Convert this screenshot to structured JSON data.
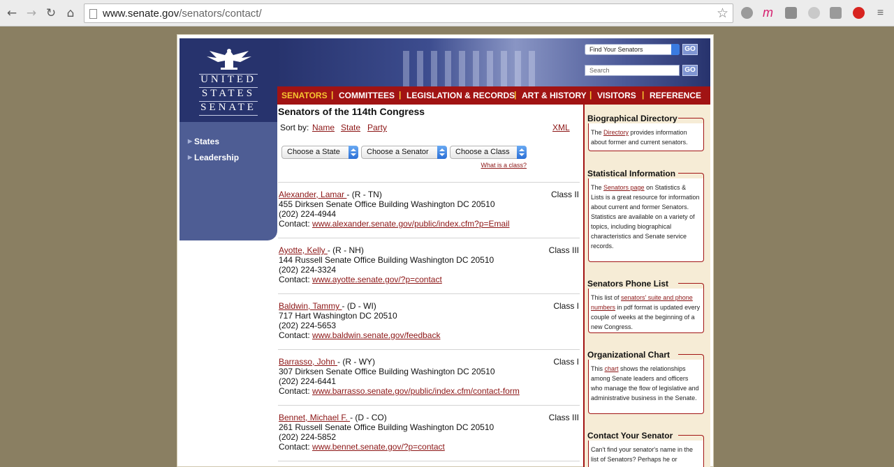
{
  "browser": {
    "url_host": "www.senate.gov",
    "url_path": "/senators/contact/",
    "back_icon": "←",
    "forward_icon": "→",
    "reload_icon": "↻",
    "home_icon": "⌂",
    "star_icon": "☆"
  },
  "logo": {
    "line1": "UNITED",
    "line2": "STATES",
    "line3": "SENATE"
  },
  "sidebar": {
    "items": [
      {
        "label": "States"
      },
      {
        "label": "Leadership"
      }
    ]
  },
  "header": {
    "find_senators": "Find Your Senators",
    "search_placeholder": "Search",
    "go_label": "GO"
  },
  "menu": {
    "items": [
      {
        "label": "SENATORS"
      },
      {
        "label": "COMMITTEES"
      },
      {
        "label": "LEGISLATION & RECORDS"
      },
      {
        "label": "ART & HISTORY"
      },
      {
        "label": "VISITORS"
      },
      {
        "label": "REFERENCE"
      }
    ],
    "separator": "|"
  },
  "main": {
    "title": "Senators of the 114th Congress",
    "sort_label": "Sort by:",
    "sort_links": [
      "Name",
      "State",
      "Party"
    ],
    "xml_label": "XML",
    "dropdowns": [
      "Choose a State",
      "Choose a Senator",
      "Choose a Class"
    ],
    "what_is_class": "What is a class?"
  },
  "senators": [
    {
      "name": "Alexander, Lamar ",
      "party_state": " - (R - TN)",
      "class": "Class II",
      "address": "455 Dirksen Senate Office Building Washington DC 20510",
      "phone": "(202) 224-4944",
      "contact_label": "Contact: ",
      "contact_url": "www.alexander.senate.gov/public/index.cfm?p=Email"
    },
    {
      "name": "Ayotte, Kelly ",
      "party_state": " - (R - NH)",
      "class": "Class III",
      "address": "144 Russell Senate Office Building Washington DC 20510",
      "phone": "(202) 224-3324",
      "contact_label": "Contact: ",
      "contact_url": "www.ayotte.senate.gov/?p=contact"
    },
    {
      "name": "Baldwin, Tammy ",
      "party_state": " - (D - WI)",
      "class": "Class I",
      "address": "717 Hart Washington DC 20510",
      "phone": "(202) 224-5653",
      "contact_label": "Contact: ",
      "contact_url": "www.baldwin.senate.gov/feedback"
    },
    {
      "name": "Barrasso, John ",
      "party_state": " - (R - WY)",
      "class": "Class I",
      "address": "307 Dirksen Senate Office Building Washington DC 20510",
      "phone": "(202) 224-6441",
      "contact_label": "Contact: ",
      "contact_url": "www.barrasso.senate.gov/public/index.cfm/contact-form"
    },
    {
      "name": "Bennet, Michael F. ",
      "party_state": " - (D - CO)",
      "class": "Class III",
      "address": "261 Russell Senate Office Building Washington DC 20510",
      "phone": "(202) 224-5852",
      "contact_label": "Contact: ",
      "contact_url": "www.bennet.senate.gov/?p=contact"
    }
  ],
  "right": {
    "bio": {
      "title": "Biographical Directory",
      "pre": "The ",
      "link": "Directory",
      "post": " provides information about former and current senators."
    },
    "stats": {
      "title": "Statistical Information",
      "pre": "The ",
      "link": "Senators page",
      "post": " on Statistics & Lists is a great resource for information about current and former Senators. Statistics are available on a variety of topics, including biographical characteristics and Senate service records."
    },
    "phone": {
      "title": "Senators Phone List",
      "pre": "This list of ",
      "link": "senators' suite and phone numbers",
      "post": " in pdf format is updated every couple of weeks at the beginning of a new Congress."
    },
    "org": {
      "title": "Organizational Chart",
      "pre": "This ",
      "link": "chart",
      "post": " shows the relationships among Senate leaders and officers who manage the flow of legislative and administrative business in the Senate."
    },
    "contact": {
      "title": "Contact Your Senator",
      "text": "Can't find your senator's name in the list of Senators?  Perhaps he or"
    }
  }
}
